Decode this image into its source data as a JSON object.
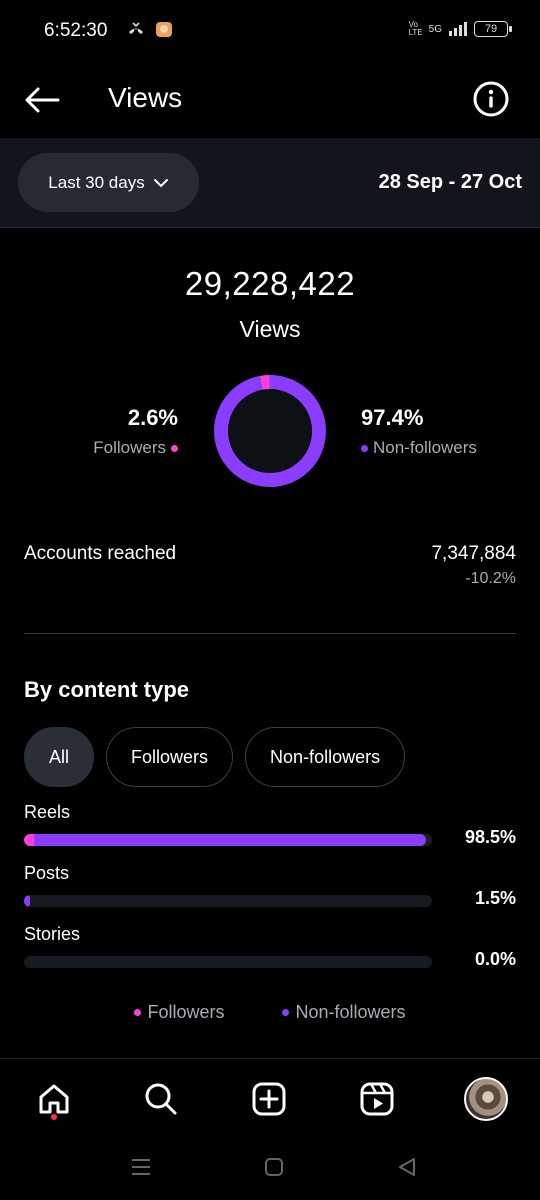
{
  "status_bar": {
    "time": "6:52:30",
    "network": "5G",
    "battery": "79"
  },
  "header": {
    "title": "Views"
  },
  "range": {
    "selector_label": "Last 30 days",
    "dates": "28 Sep - 27 Oct"
  },
  "summary": {
    "total_views": "29,228,422",
    "views_label": "Views",
    "followers_pct": "2.6%",
    "followers_label": "Followers",
    "non_followers_pct": "97.4%",
    "non_followers_label": "Non-followers",
    "followers_fraction": 0.026,
    "non_followers_fraction": 0.974
  },
  "accounts_reached": {
    "label": "Accounts reached",
    "value": "7,347,884",
    "change": "-10.2%"
  },
  "content_type": {
    "title": "By content type",
    "filters": [
      "All",
      "Followers",
      "Non-followers"
    ],
    "active_filter": "All",
    "rows": [
      {
        "label": "Reels",
        "value": "98.5%",
        "fraction": 0.985,
        "followers_fraction": 0.026
      },
      {
        "label": "Posts",
        "value": "1.5%",
        "fraction": 0.015,
        "followers_fraction": 0.0
      },
      {
        "label": "Stories",
        "value": "0.0%",
        "fraction": 0.0,
        "followers_fraction": 0.0
      }
    ],
    "legend": [
      "Followers",
      "Non-followers"
    ]
  },
  "colors": {
    "followers": "#ff3fd8",
    "non_followers": "#8a3dff",
    "background": "#000000",
    "panel": "#12161c"
  },
  "nav": {
    "items": [
      "home-icon",
      "search-icon",
      "create-icon",
      "reels-icon",
      "profile-avatar"
    ],
    "active": "home-icon"
  }
}
